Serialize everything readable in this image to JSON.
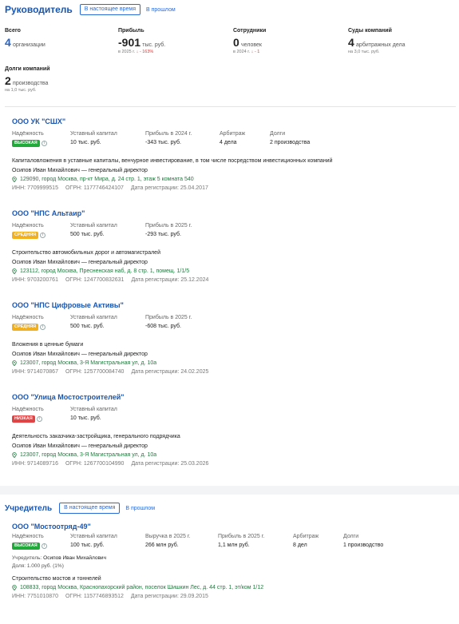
{
  "director": {
    "title": "Руководитель",
    "tab_now": "В настоящее время",
    "tab_past": "В прошлом",
    "stats": [
      {
        "label": "Всего",
        "value": "4",
        "unit": "организации",
        "sub": ""
      },
      {
        "label": "Прибыль",
        "value": "-901",
        "unit": "тыс. руб.",
        "sub_prefix": "в 2025 г.",
        "sub_arrow": "↓",
        "sub_delta": "- 163%"
      },
      {
        "label": "Сотрудники",
        "value": "0",
        "unit": "человек",
        "sub_prefix": "в 2024 г.",
        "sub_arrow": "↓",
        "sub_delta": "- 1"
      },
      {
        "label": "Суды компаний",
        "value": "4",
        "unit": "арбитражных дела",
        "sub": "на 3,0 тыс. руб."
      }
    ],
    "debts": {
      "label": "Долги компаний",
      "value": "2",
      "unit": "производства",
      "sub": "на 1,0 тыс. руб."
    },
    "companies": [
      {
        "name": "ООО УК \"СШХ\"",
        "reliability_label": "Надёжность",
        "reliability": "ВЫСОКАЯ",
        "reliability_color": "#1faa3a",
        "fields": [
          {
            "label": "Уставный капитал",
            "value": "10 тыс. руб."
          },
          {
            "label": "Прибыль в 2024 г.",
            "value": "-343 тыс. руб."
          },
          {
            "label": "Арбитраж",
            "value": "4 дела"
          },
          {
            "label": "Долги",
            "value": "2 производства"
          }
        ],
        "activity": "Капиталовложения в уставные капиталы, венчурное инвестирование, в том числе посредством инвестиционных компаний",
        "person": "Осипов Иван Михайлович — генеральный директор",
        "address": "129090, город Москва, пр-кт Мира, д. 24 стр. 1, этаж 5 комната 540",
        "inn": "ИНН: 7709999515",
        "ogrn": "ОГРН: 1177746424107",
        "reg": "Дата регистрации: 25.04.2017"
      },
      {
        "name": "ООО \"НПС Альтаир\"",
        "reliability_label": "Надёжность",
        "reliability": "СРЕДНЯЯ",
        "reliability_color": "#f2b01e",
        "fields": [
          {
            "label": "Уставный капитал",
            "value": "500 тыс. руб."
          },
          {
            "label": "Прибыль в 2025 г.",
            "value": "-293 тыс. руб."
          }
        ],
        "activity": "Строительство автомобильных дорог и автомагистралей",
        "person": "Осипов Иван Михайлович — генеральный директор",
        "address": "123112, город Москва, Пресненская наб, д. 8 стр. 1, помещ. 1/1/5",
        "inn": "ИНН: 9703200761",
        "ogrn": "ОГРН: 1247700832631",
        "reg": "Дата регистрации: 25.12.2024"
      },
      {
        "name": "ООО \"НПС Цифровые Активы\"",
        "reliability_label": "Надёжность",
        "reliability": "СРЕДНЯЯ",
        "reliability_color": "#f2b01e",
        "fields": [
          {
            "label": "Уставный капитал",
            "value": "500 тыс. руб."
          },
          {
            "label": "Прибыль в 2025 г.",
            "value": "-608 тыс. руб."
          }
        ],
        "activity": "Вложения в ценные бумаги",
        "person": "Осипов Иван Михайлович — генеральный директор",
        "address": "123007, город Москва, 3-Я Магистральная ул, д. 10а",
        "inn": "ИНН: 9714070867",
        "ogrn": "ОГРН: 1257700084740",
        "reg": "Дата регистрации: 24.02.2025"
      },
      {
        "name": "ООО \"Улица Мостостроителей\"",
        "reliability_label": "Надёжность",
        "reliability": "НИЗКАЯ",
        "reliability_color": "#e04444",
        "fields": [
          {
            "label": "Уставный капитал",
            "value": "10 тыс. руб."
          }
        ],
        "activity": "Деятельность заказчика-застройщика, генерального подрядчика",
        "person": "Осипов Иван Михайлович — генеральный директор",
        "address": "123007, город Москва, 3-Я Магистральная ул, д. 10а",
        "inn": "ИНН: 9714089716",
        "ogrn": "ОГРН: 1267700104990",
        "reg": "Дата регистрации: 25.03.2026"
      }
    ]
  },
  "founder": {
    "title": "Учредитель",
    "tab_now": "В настоящее время",
    "tab_past": "В прошлом",
    "company": {
      "name": "ООО \"Мостоотряд-49\"",
      "reliability_label": "Надёжность",
      "reliability": "ВЫСОКАЯ",
      "reliability_color": "#1faa3a",
      "fields": [
        {
          "label": "Уставный капитал",
          "value": "100 тыс. руб."
        },
        {
          "label": "Выручка в 2025 г.",
          "value": "266 млн руб."
        },
        {
          "label": "Прибыль в 2025 г.",
          "value": "1,1 млн руб."
        },
        {
          "label": "Арбитраж",
          "value": "8 дел"
        },
        {
          "label": "Долги",
          "value": "1 производство"
        }
      ],
      "founders_label": "Учредитель:",
      "founders_value": "Осипов Иван Михайлович",
      "share": "Доля: 1.000 руб. (1%)",
      "activity": "Строительство мостов и тоннелей",
      "address": "108833, город Москва, Краснопахорский район, поселок Шишкин Лес, д. 44 стр. 1, эт/ком 1/12",
      "inn": "ИНН: 7751010870",
      "ogrn": "ОГРН: 1157746893512",
      "reg": "Дата регистрации: 29.09.2015"
    }
  },
  "colors": {
    "accent": "#1a56b0",
    "green": "#1f7a3d",
    "red": "#d23a3a"
  }
}
